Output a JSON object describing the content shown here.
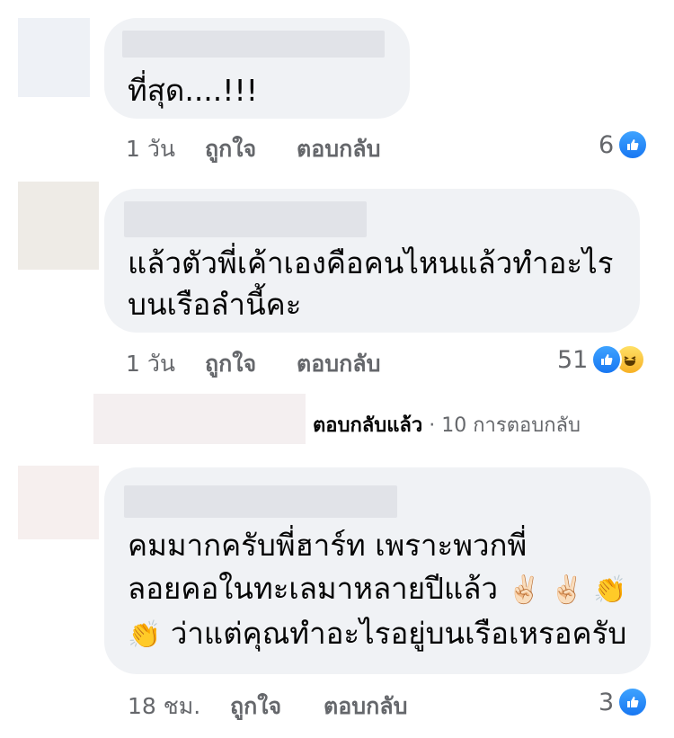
{
  "comments": [
    {
      "text_lines": [
        "ที่สุด....!!!"
      ],
      "time": "1 วัน",
      "like_label": "ถูกใจ",
      "reply_label": "ตอบกลับ",
      "reaction_count": "6",
      "reactions": [
        "like"
      ]
    },
    {
      "text_lines": [
        "แล้วตัวพี่เค้าเองคือคนไหนแล้วทำอะไร",
        "บนเรือลำนี้คะ"
      ],
      "time": "1 วัน",
      "like_label": "ถูกใจ",
      "reply_label": "ตอบกลับ",
      "reaction_count": "51",
      "reactions": [
        "like",
        "haha"
      ]
    },
    {
      "text_lines": [
        "คมมากครับพี่ฮาร์ท เพราะพวกพี่",
        "ลอยคอในทะเลมาหลายปีแล้ว",
        "ว่าแต่คุณทำอะไรอยู่บนเรือเหรอครับ"
      ],
      "emojis": [
        "✌🏻",
        "✌🏻",
        "👏",
        "👏"
      ],
      "time": "18 ชม.",
      "like_label": "ถูกใจ",
      "reply_label": "ตอบกลับ",
      "reaction_count": "3",
      "reactions": [
        "like"
      ]
    }
  ],
  "reply_summary": {
    "replied": "ตอบกลับแล้ว",
    "separator": "·",
    "count": "10 การตอบกลับ"
  },
  "icons": {
    "like": "thumbs-up-icon",
    "haha": "laughing-face-icon"
  },
  "colors": {
    "bubble": "#f0f2f5",
    "meta": "#65676b",
    "like_blue": "#1877f2"
  }
}
